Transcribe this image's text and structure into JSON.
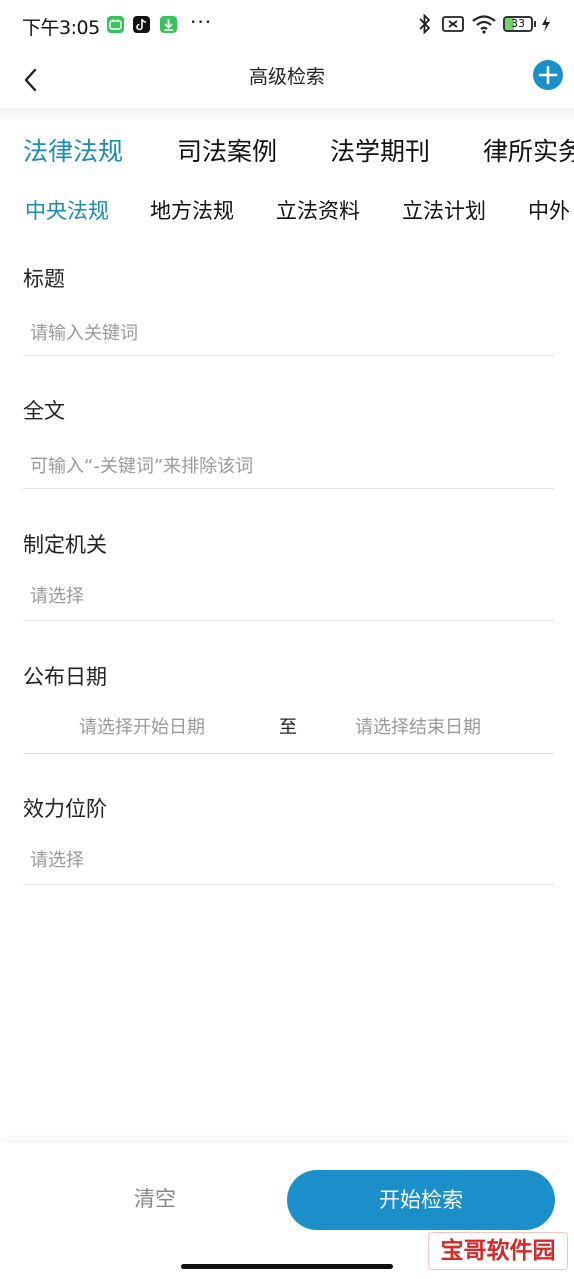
{
  "status_bar": {
    "time": "下午3:05",
    "more": "···",
    "battery_level": "33",
    "battery_fraction": 0.33
  },
  "header": {
    "title": "高级检索",
    "back_icon": "chevron-left-icon",
    "add_icon": "plus-circle-icon"
  },
  "tabs": [
    {
      "label": "法律法规",
      "active": true
    },
    {
      "label": "司法案例",
      "active": false
    },
    {
      "label": "法学期刊",
      "active": false
    },
    {
      "label": "律所实务",
      "active": false
    }
  ],
  "subtabs": [
    {
      "label": "中央法规",
      "active": true
    },
    {
      "label": "地方法规",
      "active": false
    },
    {
      "label": "立法资料",
      "active": false
    },
    {
      "label": "立法计划",
      "active": false
    },
    {
      "label": "中外",
      "active": false
    }
  ],
  "form": {
    "title": {
      "label": "标题",
      "placeholder": "请输入关键词",
      "value": ""
    },
    "fulltext": {
      "label": "全文",
      "placeholder": "可输入“-关键词”来排除该词",
      "value": ""
    },
    "authority": {
      "label": "制定机关",
      "value": "请选择"
    },
    "publish_date": {
      "label": "公布日期",
      "start": "请选择开始日期",
      "separator": "至",
      "end": "请选择结束日期"
    },
    "level": {
      "label": "效力位阶",
      "value": "请选择"
    }
  },
  "footer": {
    "clear_label": "清空",
    "search_label": "开始检索"
  },
  "watermark": "宝哥软件园",
  "colors": {
    "accent": "#1a8fc9",
    "active_tab": "#1b8bb8",
    "placeholder": "#9a9a9a",
    "divider": "#e3e3e3",
    "watermark": "#d42a2a"
  }
}
